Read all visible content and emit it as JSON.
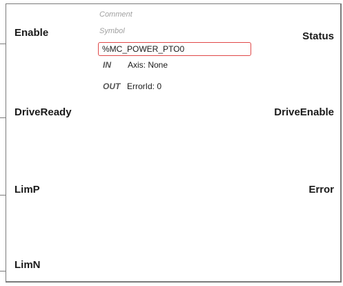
{
  "block": {
    "comment_label": "Comment",
    "symbol_label": "Symbol",
    "symbol_value": "%MC_POWER_PTO0"
  },
  "params": [
    {
      "direction": "IN",
      "text": "Axis: None"
    },
    {
      "direction": "OUT",
      "text": "ErrorId: 0"
    }
  ],
  "inputs": [
    "Enable",
    "DriveReady",
    "LimP",
    "LimN"
  ],
  "outputs": [
    "Status",
    "DriveEnable",
    "Error"
  ]
}
